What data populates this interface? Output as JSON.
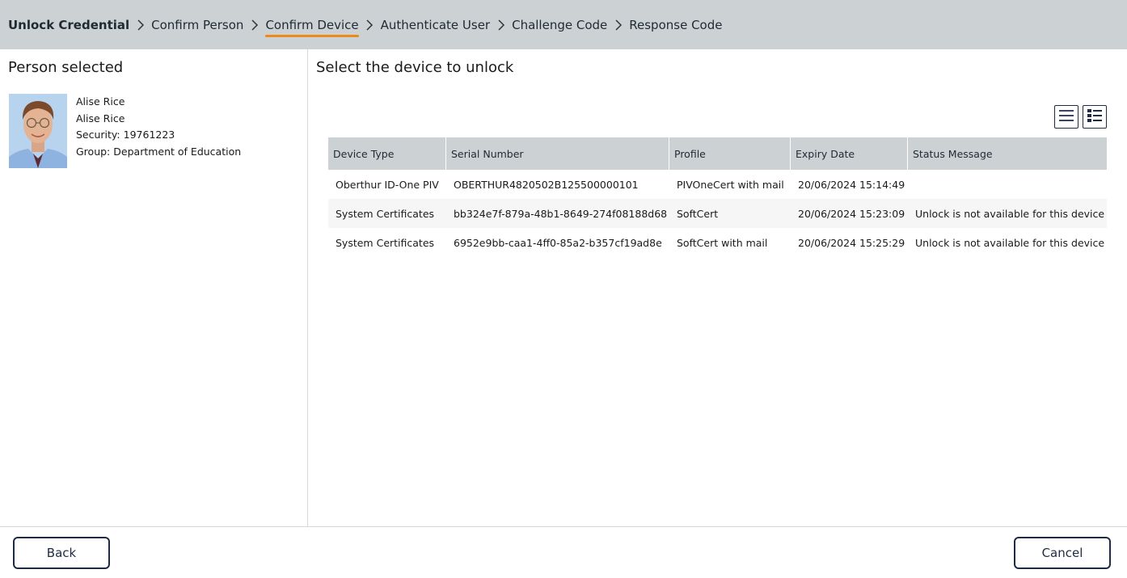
{
  "breadcrumb": {
    "steps": [
      "Unlock Credential",
      "Confirm Person",
      "Confirm Device",
      "Authenticate User",
      "Challenge Code",
      "Response Code"
    ],
    "active_index": 2
  },
  "left_panel": {
    "title": "Person selected",
    "person": {
      "line1": "Alise Rice",
      "line2": "Alise Rice",
      "security_label": "Security:",
      "security_value": "19761223",
      "group_label": "Group:",
      "group_value": "Department of Education"
    }
  },
  "right_panel": {
    "title": "Select the device to unlock",
    "view_buttons": {
      "list_icon": "list-view-icon",
      "detail_icon": "detail-view-icon"
    },
    "table": {
      "columns": [
        "Device Type",
        "Serial Number",
        "Profile",
        "Expiry Date",
        "Status Message"
      ],
      "rows": [
        [
          "Oberthur ID-One PIV",
          "OBERTHUR4820502B125500000101",
          "PIVOneCert with mail",
          "20/06/2024 15:14:49",
          ""
        ],
        [
          "System Certificates",
          "bb324e7f-879a-48b1-8649-274f08188d68",
          "SoftCert",
          "20/06/2024 15:23:09",
          "Unlock is not available for this device"
        ],
        [
          "System Certificates",
          "6952e9bb-caa1-4ff0-85a2-b357cf19ad8e",
          "SoftCert with mail",
          "20/06/2024 15:25:29",
          "Unlock is not available for this device"
        ]
      ]
    }
  },
  "footer": {
    "back_label": "Back",
    "cancel_label": "Cancel"
  },
  "colors": {
    "header_bg": "#ccd1d4",
    "active_underline": "#ee8a1a",
    "button_border": "#1f2a44"
  }
}
